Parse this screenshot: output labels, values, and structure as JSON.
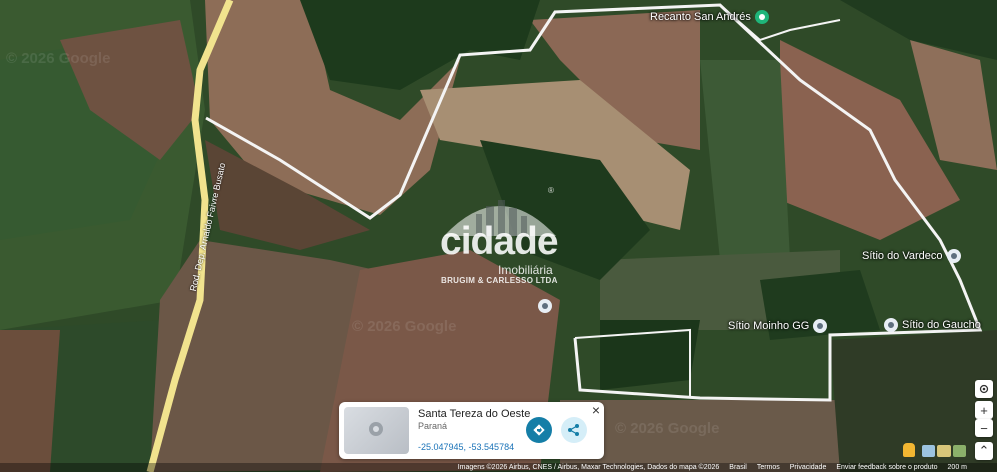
{
  "places": [
    {
      "name": "Recanto San Andrés",
      "icon": "park-pin-icon"
    },
    {
      "name": "Sítio do Vardeco",
      "icon": "location-pin-icon"
    },
    {
      "name": "Sítio Moinho GG",
      "icon": "location-pin-icon"
    },
    {
      "name": "Sítio do Gaucho",
      "icon": "location-pin-icon"
    }
  ],
  "road_label": "Rod. Dep. Arnaldo Faivre Busato",
  "watermarks": [
    "© 2026 Google",
    "© 2026 Google",
    "© 2026 Google"
  ],
  "logo": {
    "word": "cidade",
    "subtitle": "Imobiliária",
    "company": "BRUGIM & CARLESSO LTDA",
    "reg": "®"
  },
  "card": {
    "title": "Santa Tereza do Oeste",
    "subtitle": "Paraná",
    "coords": "-25.047945, -53.545784",
    "close": "×"
  },
  "controls": {
    "zoom_in": "+",
    "zoom_out": "−",
    "expand": "⌃"
  },
  "attribution": {
    "imagery": "Imagens ©2026 Airbus, CNES / Airbus, Maxar Technologies, Dados do mapa ©2026",
    "country": "Brasil",
    "terms": "Termos",
    "privacy": "Privacidade",
    "feedback": "Enviar feedback sobre o produto",
    "scale": "200 m"
  },
  "colors": {
    "boundary": "#f4f4f4",
    "road": "#f3e58a",
    "field_brown": "#8a6a52",
    "forest": "#1f3b1d",
    "field_green": "#3e6a33"
  }
}
